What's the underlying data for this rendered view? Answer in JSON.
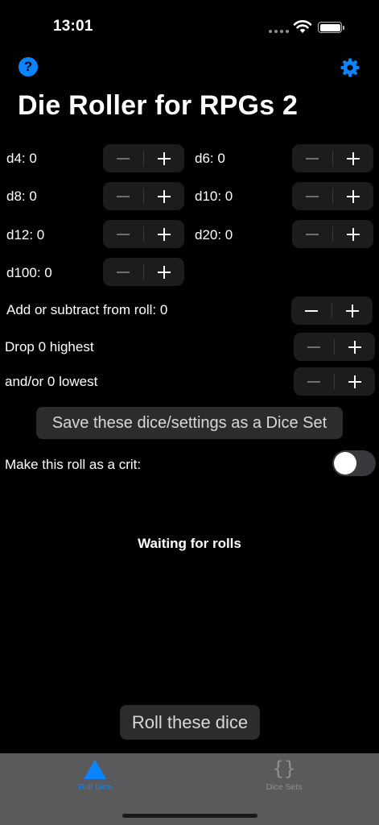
{
  "status_bar": {
    "time": "13:01"
  },
  "title": "Die Roller for RPGs 2",
  "dice": [
    {
      "label": "d4: 0"
    },
    {
      "label": "d6: 0"
    },
    {
      "label": "d8: 0"
    },
    {
      "label": "d10: 0"
    },
    {
      "label": "d12: 0"
    },
    {
      "label": "d20: 0"
    },
    {
      "label": "d100: 0"
    }
  ],
  "modifier": {
    "label": "Add or subtract from roll: 0"
  },
  "drop_highest": {
    "label": "Drop 0 highest"
  },
  "drop_lowest": {
    "label": "and/or 0 lowest"
  },
  "save_button": "Save these dice/settings as a Dice Set",
  "crit": {
    "label": "Make this roll as a crit:",
    "enabled": false
  },
  "result_text": "Waiting for rolls",
  "roll_button": "Roll these dice",
  "tabs": [
    {
      "label": "Roll Dice",
      "icon": "triangle-icon",
      "selected": true
    },
    {
      "label": "Dice Sets",
      "icon": "braces-icon",
      "selected": false
    }
  ],
  "colors": {
    "accent": "#0a84ff",
    "background": "#000000",
    "tab_bar": "#5a5a5c"
  }
}
